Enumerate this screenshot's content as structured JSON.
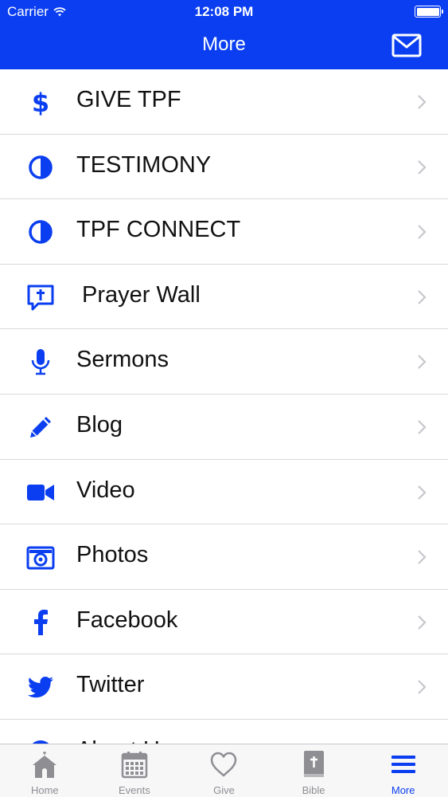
{
  "status_bar": {
    "carrier": "Carrier",
    "time": "12:08 PM"
  },
  "nav": {
    "title": "More"
  },
  "colors": {
    "accent": "#0a3ef0",
    "inactive": "#8e8e93"
  },
  "menu": {
    "items": [
      {
        "label": "GIVE TPF",
        "icon": "dollar-icon"
      },
      {
        "label": "TESTIMONY",
        "icon": "half-circle-icon"
      },
      {
        "label": "TPF CONNECT",
        "icon": "half-circle-icon"
      },
      {
        "label": "Prayer Wall",
        "icon": "prayer-bubble-icon"
      },
      {
        "label": "Sermons",
        "icon": "microphone-icon"
      },
      {
        "label": "Blog",
        "icon": "pencil-icon"
      },
      {
        "label": "Video",
        "icon": "video-camera-icon"
      },
      {
        "label": "Photos",
        "icon": "camera-icon"
      },
      {
        "label": "Facebook",
        "icon": "facebook-icon"
      },
      {
        "label": "Twitter",
        "icon": "twitter-icon"
      },
      {
        "label": "About Us",
        "icon": "info-icon"
      }
    ]
  },
  "tabbar": {
    "tabs": [
      {
        "label": "Home",
        "icon": "home-icon",
        "active": false
      },
      {
        "label": "Events",
        "icon": "calendar-icon",
        "active": false
      },
      {
        "label": "Give",
        "icon": "heart-icon",
        "active": false
      },
      {
        "label": "Bible",
        "icon": "bible-icon",
        "active": false
      },
      {
        "label": "More",
        "icon": "menu-icon",
        "active": true
      }
    ]
  }
}
